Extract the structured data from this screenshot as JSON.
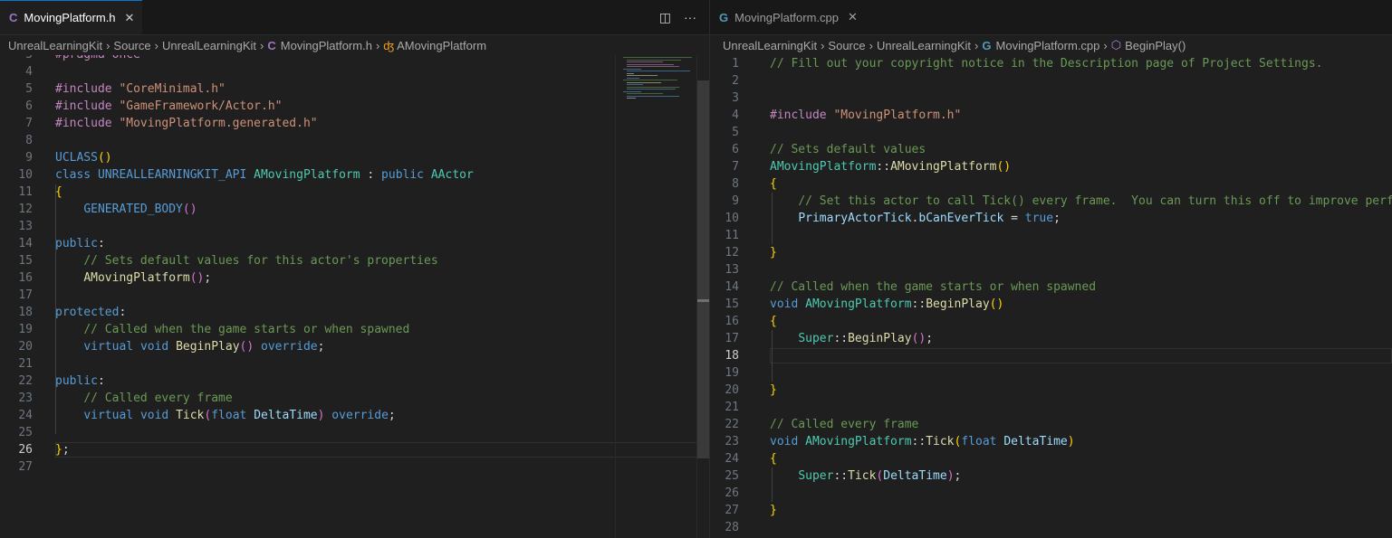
{
  "left": {
    "tab": {
      "icon_glyph": "C",
      "label": "MovingPlatform.h",
      "close_glyph": "✕"
    },
    "actions": {
      "split_glyph": "◫",
      "more_glyph": "···"
    },
    "breadcrumb": [
      "UnrealLearningKit",
      "Source",
      "UnrealLearningKit",
      "MovingPlatform.h",
      "AMovingPlatform"
    ],
    "code": [
      {
        "n": "3",
        "t": [
          [
            "#pragma once",
            "c-inc"
          ]
        ]
      },
      {
        "n": "4",
        "t": []
      },
      {
        "n": "5",
        "t": [
          [
            "#include ",
            "c-inc"
          ],
          [
            "\"CoreMinimal.h\"",
            "c-str"
          ]
        ]
      },
      {
        "n": "6",
        "t": [
          [
            "#include ",
            "c-inc"
          ],
          [
            "\"GameFramework/Actor.h\"",
            "c-str"
          ]
        ]
      },
      {
        "n": "7",
        "t": [
          [
            "#include ",
            "c-inc"
          ],
          [
            "\"MovingPlatform.generated.h\"",
            "c-str"
          ]
        ]
      },
      {
        "n": "8",
        "t": []
      },
      {
        "n": "9",
        "t": [
          [
            "UCLASS",
            "c-mac"
          ],
          [
            "()",
            "c-b1"
          ]
        ]
      },
      {
        "n": "10",
        "t": [
          [
            "class ",
            "c-kw"
          ],
          [
            "UNREALLEARNINGKIT_API ",
            "c-mac"
          ],
          [
            "AMovingPlatform",
            "c-cls"
          ],
          [
            " : ",
            "c-pun"
          ],
          [
            "public ",
            "c-kw"
          ],
          [
            "AActor",
            "c-cls"
          ]
        ]
      },
      {
        "n": "11",
        "t": [
          [
            "{",
            "c-b1"
          ]
        ]
      },
      {
        "n": "12",
        "t": [
          [
            "    ",
            "c-pun"
          ],
          [
            "GENERATED_BODY",
            "c-mac"
          ],
          [
            "()",
            "c-b2"
          ]
        ]
      },
      {
        "n": "13",
        "t": []
      },
      {
        "n": "14",
        "t": [
          [
            "public",
            "c-kw"
          ],
          [
            ":",
            "c-pun"
          ]
        ]
      },
      {
        "n": "15",
        "t": [
          [
            "    ",
            "c-pun"
          ],
          [
            "// Sets default values for this actor's properties",
            "c-cm"
          ]
        ]
      },
      {
        "n": "16",
        "t": [
          [
            "    ",
            "c-pun"
          ],
          [
            "AMovingPlatform",
            "c-fn"
          ],
          [
            "()",
            "c-b2"
          ],
          [
            ";",
            "c-pun"
          ]
        ]
      },
      {
        "n": "17",
        "t": []
      },
      {
        "n": "18",
        "t": [
          [
            "protected",
            "c-kw"
          ],
          [
            ":",
            "c-pun"
          ]
        ]
      },
      {
        "n": "19",
        "t": [
          [
            "    ",
            "c-pun"
          ],
          [
            "// Called when the game starts or when spawned",
            "c-cm"
          ]
        ]
      },
      {
        "n": "20",
        "t": [
          [
            "    ",
            "c-pun"
          ],
          [
            "virtual ",
            "c-kw"
          ],
          [
            "void ",
            "c-kw"
          ],
          [
            "BeginPlay",
            "c-fn"
          ],
          [
            "()",
            "c-b2"
          ],
          [
            " override",
            "c-kw"
          ],
          [
            ";",
            "c-pun"
          ]
        ]
      },
      {
        "n": "21",
        "t": []
      },
      {
        "n": "22",
        "t": [
          [
            "public",
            "c-kw"
          ],
          [
            ":",
            "c-pun"
          ]
        ]
      },
      {
        "n": "23",
        "t": [
          [
            "    ",
            "c-pun"
          ],
          [
            "// Called every frame",
            "c-cm"
          ]
        ]
      },
      {
        "n": "24",
        "t": [
          [
            "    ",
            "c-pun"
          ],
          [
            "virtual ",
            "c-kw"
          ],
          [
            "void ",
            "c-kw"
          ],
          [
            "Tick",
            "c-fn"
          ],
          [
            "(",
            "c-b2"
          ],
          [
            "float ",
            "c-kw"
          ],
          [
            "DeltaTime",
            "c-var"
          ],
          [
            ")",
            "c-b2"
          ],
          [
            " override",
            "c-kw"
          ],
          [
            ";",
            "c-pun"
          ]
        ]
      },
      {
        "n": "25",
        "t": []
      },
      {
        "n": "26",
        "t": [
          [
            "}",
            "c-b1"
          ],
          [
            ";",
            "c-pun"
          ]
        ]
      },
      {
        "n": "27",
        "t": []
      }
    ],
    "current_line": "26"
  },
  "right": {
    "tab": {
      "icon_glyph": "G",
      "label": "MovingPlatform.cpp",
      "close_glyph": "✕"
    },
    "breadcrumb": [
      "UnrealLearningKit",
      "Source",
      "UnrealLearningKit",
      "MovingPlatform.cpp",
      "BeginPlay()"
    ],
    "code": [
      {
        "n": "1",
        "t": [
          [
            "// Fill out your copyright notice in the Description page of Project Settings.",
            "c-cm"
          ]
        ]
      },
      {
        "n": "2",
        "t": []
      },
      {
        "n": "3",
        "t": []
      },
      {
        "n": "4",
        "t": [
          [
            "#include ",
            "c-inc"
          ],
          [
            "\"MovingPlatform.h\"",
            "c-str"
          ]
        ]
      },
      {
        "n": "5",
        "t": []
      },
      {
        "n": "6",
        "t": [
          [
            "// Sets default values",
            "c-cm"
          ]
        ]
      },
      {
        "n": "7",
        "t": [
          [
            "AMovingPlatform",
            "c-cls"
          ],
          [
            "::",
            "c-pun"
          ],
          [
            "AMovingPlatform",
            "c-fn"
          ],
          [
            "()",
            "c-b1"
          ]
        ]
      },
      {
        "n": "8",
        "t": [
          [
            "{",
            "c-b1"
          ]
        ]
      },
      {
        "n": "9",
        "t": [
          [
            "    ",
            "c-pun"
          ],
          [
            "// Set this actor to call Tick() every frame.  You can turn this off to improve performance if you don't need it.",
            "c-cm"
          ]
        ]
      },
      {
        "n": "10",
        "t": [
          [
            "    ",
            "c-pun"
          ],
          [
            "PrimaryActorTick",
            "c-var"
          ],
          [
            ".",
            "c-pun"
          ],
          [
            "bCanEverTick",
            "c-var"
          ],
          [
            " = ",
            "c-pun"
          ],
          [
            "true",
            "c-kw"
          ],
          [
            ";",
            "c-pun"
          ]
        ]
      },
      {
        "n": "11",
        "t": []
      },
      {
        "n": "12",
        "t": [
          [
            "}",
            "c-b1"
          ]
        ]
      },
      {
        "n": "13",
        "t": []
      },
      {
        "n": "14",
        "t": [
          [
            "// Called when the game starts or when spawned",
            "c-cm"
          ]
        ]
      },
      {
        "n": "15",
        "t": [
          [
            "void ",
            "c-kw"
          ],
          [
            "AMovingPlatform",
            "c-cls"
          ],
          [
            "::",
            "c-pun"
          ],
          [
            "BeginPlay",
            "c-fn"
          ],
          [
            "()",
            "c-b1"
          ]
        ]
      },
      {
        "n": "16",
        "t": [
          [
            "{",
            "c-b1"
          ]
        ]
      },
      {
        "n": "17",
        "t": [
          [
            "    ",
            "c-pun"
          ],
          [
            "Super",
            "c-cls"
          ],
          [
            "::",
            "c-pun"
          ],
          [
            "BeginPlay",
            "c-fn"
          ],
          [
            "()",
            "c-b2"
          ],
          [
            ";",
            "c-pun"
          ]
        ]
      },
      {
        "n": "18",
        "t": []
      },
      {
        "n": "19",
        "t": []
      },
      {
        "n": "20",
        "t": [
          [
            "}",
            "c-b1"
          ]
        ]
      },
      {
        "n": "21",
        "t": []
      },
      {
        "n": "22",
        "t": [
          [
            "// Called every frame",
            "c-cm"
          ]
        ]
      },
      {
        "n": "23",
        "t": [
          [
            "void ",
            "c-kw"
          ],
          [
            "AMovingPlatform",
            "c-cls"
          ],
          [
            "::",
            "c-pun"
          ],
          [
            "Tick",
            "c-fn"
          ],
          [
            "(",
            "c-b1"
          ],
          [
            "float ",
            "c-kw"
          ],
          [
            "DeltaTime",
            "c-var"
          ],
          [
            ")",
            "c-b1"
          ]
        ]
      },
      {
        "n": "24",
        "t": [
          [
            "{",
            "c-b1"
          ]
        ]
      },
      {
        "n": "25",
        "t": [
          [
            "    ",
            "c-pun"
          ],
          [
            "Super",
            "c-cls"
          ],
          [
            "::",
            "c-pun"
          ],
          [
            "Tick",
            "c-fn"
          ],
          [
            "(",
            "c-b2"
          ],
          [
            "DeltaTime",
            "c-var"
          ],
          [
            ")",
            "c-b2"
          ],
          [
            ";",
            "c-pun"
          ]
        ]
      },
      {
        "n": "26",
        "t": []
      },
      {
        "n": "27",
        "t": [
          [
            "}",
            "c-b1"
          ]
        ]
      },
      {
        "n": "28",
        "t": []
      }
    ],
    "current_line": "18"
  },
  "colors": {
    "background": "#1f1f1f",
    "tabbar": "#181818",
    "accent": "#0078d4"
  }
}
